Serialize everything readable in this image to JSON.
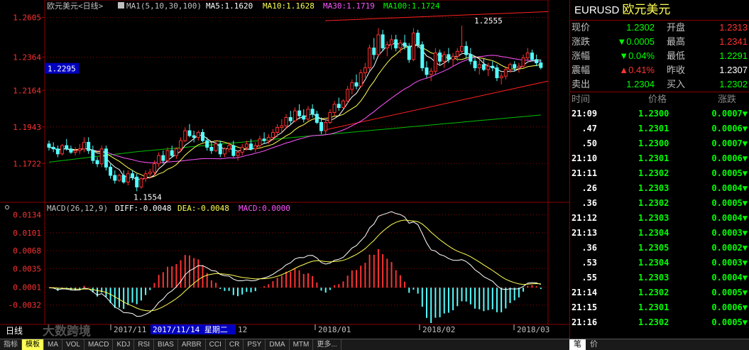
{
  "header": {
    "title": "欧元美元<日线>",
    "ma_label": "MA1(5,10,30,100)",
    "ma5": "MA5:1.1620",
    "ma10": "MA10:1.1628",
    "ma30": "MA30:1.1719",
    "ma100": "MA100:1.1724"
  },
  "price_axis": [
    "1.2605",
    "1.2364",
    "1.2164",
    "1.1943",
    "1.1722"
  ],
  "current_price_tag": "1.2295",
  "annotations": {
    "high": "1.2555",
    "low": "1.1554"
  },
  "macd": {
    "label": "MACD(26,12,9)",
    "diff": "DIFF:-0.0048",
    "dea": "DEA:-0.0048",
    "macd": "MACD:0.0000",
    "axis": [
      "0.0134",
      "0.0101",
      "0.0068",
      "0.0035",
      "0.0001",
      "-0.0032"
    ]
  },
  "date_axis": {
    "period": "日线",
    "labels": [
      "2017/11",
      "12",
      "2018/01",
      "2018/02",
      "2018/03"
    ],
    "cursor": "2017/11/14 星期二"
  },
  "watermark": "大数跨境",
  "tabs": [
    "指标",
    "模板",
    "MA",
    "VOL",
    "MACD",
    "KDJ",
    "RSI",
    "BIAS",
    "ARBR",
    "CCI",
    "CR",
    "PSY",
    "DMA",
    "MTM",
    "更多..."
  ],
  "panel": {
    "symbol": "EURUSD",
    "name": "欧元美元",
    "quotes": [
      {
        "l1": "现价",
        "v1": "1.2302",
        "c1": "green",
        "l2": "开盘",
        "v2": "1.2313",
        "c2": "red"
      },
      {
        "l1": "涨跌",
        "v1": "▼0.0005",
        "c1": "green",
        "l2": "最高",
        "v2": "1.2341",
        "c2": "red"
      },
      {
        "l1": "涨幅",
        "v1": "▼0.04%",
        "c1": "green",
        "l2": "最低",
        "v2": "1.2291",
        "c2": "green"
      },
      {
        "l1": "震幅",
        "v1": "▲0.41%",
        "c1": "red",
        "l2": "昨收",
        "v2": "1.2307",
        "c2": "white"
      },
      {
        "l1": "卖出",
        "v1": "1.2304",
        "c1": "green",
        "l2": "买入",
        "v2": "1.2302",
        "c2": "green"
      }
    ],
    "tick_headers": [
      "时间",
      "价格",
      "涨跌"
    ],
    "ticks": [
      {
        "t": "21:09",
        "p": "1.2300",
        "c": "0.0007▼"
      },
      {
        "t": ".47",
        "p": "1.2301",
        "c": "0.0006▼"
      },
      {
        "t": ".50",
        "p": "1.2300",
        "c": "0.0007▼"
      },
      {
        "t": "21:10",
        "p": "1.2301",
        "c": "0.0006▼"
      },
      {
        "t": "21:11",
        "p": "1.2302",
        "c": "0.0005▼"
      },
      {
        "t": ".26",
        "p": "1.2303",
        "c": "0.0004▼"
      },
      {
        "t": ".36",
        "p": "1.2302",
        "c": "0.0005▼"
      },
      {
        "t": "21:12",
        "p": "1.2303",
        "c": "0.0004▼"
      },
      {
        "t": "21:13",
        "p": "1.2304",
        "c": "0.0003▼"
      },
      {
        "t": ".36",
        "p": "1.2305",
        "c": "0.0002▼"
      },
      {
        "t": ".53",
        "p": "1.2304",
        "c": "0.0003▼"
      },
      {
        "t": ".55",
        "p": "1.2303",
        "c": "0.0004▼"
      },
      {
        "t": "21:14",
        "p": "1.2302",
        "c": "0.0005▼"
      },
      {
        "t": "21:15",
        "p": "1.2301",
        "c": "0.0006▼"
      },
      {
        "t": "21:16",
        "p": "1.2302",
        "c": "0.0005▼"
      }
    ],
    "bottom_tabs": [
      "笔",
      "价"
    ]
  },
  "colors": {
    "up": "#ff3232",
    "down": "#54ffff",
    "ma5": "#ffffff",
    "ma10": "#ffff54",
    "ma30": "#ff54ff",
    "ma100": "#00c000",
    "grid": "#8b0000",
    "trend": "#ff2020"
  },
  "chart_data": {
    "type": "candlestick",
    "price_range": [
      1.15,
      1.265
    ],
    "candles": [
      [
        1.184,
        1.186,
        1.18,
        1.182
      ],
      [
        1.182,
        1.185,
        1.179,
        1.181
      ],
      [
        1.181,
        1.183,
        1.176,
        1.178
      ],
      [
        1.178,
        1.184,
        1.177,
        1.183
      ],
      [
        1.183,
        1.187,
        1.18,
        1.181
      ],
      [
        1.181,
        1.183,
        1.178,
        1.179
      ],
      [
        1.179,
        1.182,
        1.177,
        1.18
      ],
      [
        1.18,
        1.184,
        1.178,
        1.181
      ],
      [
        1.181,
        1.188,
        1.179,
        1.185
      ],
      [
        1.185,
        1.188,
        1.178,
        1.18
      ],
      [
        1.18,
        1.183,
        1.172,
        1.174
      ],
      [
        1.174,
        1.176,
        1.17,
        1.172
      ],
      [
        1.172,
        1.183,
        1.17,
        1.181
      ],
      [
        1.181,
        1.183,
        1.168,
        1.17
      ],
      [
        1.17,
        1.172,
        1.163,
        1.165
      ],
      [
        1.165,
        1.168,
        1.16,
        1.162
      ],
      [
        1.162,
        1.166,
        1.161,
        1.165
      ],
      [
        1.165,
        1.168,
        1.16,
        1.161
      ],
      [
        1.161,
        1.168,
        1.159,
        1.166
      ],
      [
        1.166,
        1.168,
        1.162,
        1.164
      ],
      [
        1.164,
        1.166,
        1.1554,
        1.158
      ],
      [
        1.158,
        1.164,
        1.157,
        1.163
      ],
      [
        1.163,
        1.168,
        1.161,
        1.166
      ],
      [
        1.166,
        1.169,
        1.163,
        1.167
      ],
      [
        1.167,
        1.174,
        1.165,
        1.172
      ],
      [
        1.172,
        1.179,
        1.17,
        1.177
      ],
      [
        1.177,
        1.18,
        1.172,
        1.174
      ],
      [
        1.174,
        1.182,
        1.173,
        1.18
      ],
      [
        1.18,
        1.183,
        1.176,
        1.177
      ],
      [
        1.177,
        1.182,
        1.175,
        1.181
      ],
      [
        1.181,
        1.188,
        1.179,
        1.186
      ],
      [
        1.186,
        1.194,
        1.185,
        1.192
      ],
      [
        1.192,
        1.196,
        1.188,
        1.189
      ],
      [
        1.189,
        1.192,
        1.185,
        1.188
      ],
      [
        1.188,
        1.192,
        1.186,
        1.191
      ],
      [
        1.191,
        1.193,
        1.185,
        1.186
      ],
      [
        1.186,
        1.188,
        1.18,
        1.182
      ],
      [
        1.182,
        1.185,
        1.178,
        1.18
      ],
      [
        1.18,
        1.186,
        1.179,
        1.184
      ],
      [
        1.184,
        1.186,
        1.176,
        1.178
      ],
      [
        1.178,
        1.182,
        1.176,
        1.181
      ],
      [
        1.181,
        1.185,
        1.179,
        1.183
      ],
      [
        1.183,
        1.186,
        1.176,
        1.177
      ],
      [
        1.177,
        1.18,
        1.174,
        1.179
      ],
      [
        1.179,
        1.184,
        1.177,
        1.182
      ],
      [
        1.182,
        1.186,
        1.18,
        1.184
      ],
      [
        1.184,
        1.187,
        1.18,
        1.181
      ],
      [
        1.181,
        1.185,
        1.179,
        1.183
      ],
      [
        1.183,
        1.189,
        1.181,
        1.187
      ],
      [
        1.187,
        1.191,
        1.184,
        1.186
      ],
      [
        1.186,
        1.19,
        1.184,
        1.188
      ],
      [
        1.188,
        1.193,
        1.186,
        1.191
      ],
      [
        1.191,
        1.196,
        1.188,
        1.194
      ],
      [
        1.194,
        1.199,
        1.191,
        1.195
      ],
      [
        1.195,
        1.202,
        1.193,
        1.2
      ],
      [
        1.2,
        1.204,
        1.196,
        1.198
      ],
      [
        1.198,
        1.206,
        1.197,
        1.204
      ],
      [
        1.204,
        1.208,
        1.199,
        1.201
      ],
      [
        1.201,
        1.205,
        1.197,
        1.199
      ],
      [
        1.199,
        1.207,
        1.198,
        1.205
      ],
      [
        1.205,
        1.208,
        1.2,
        1.202
      ],
      [
        1.202,
        1.204,
        1.196,
        1.197
      ],
      [
        1.197,
        1.2,
        1.19,
        1.192
      ],
      [
        1.192,
        1.199,
        1.19,
        1.197
      ],
      [
        1.197,
        1.205,
        1.196,
        1.203
      ],
      [
        1.203,
        1.21,
        1.201,
        1.208
      ],
      [
        1.208,
        1.212,
        1.204,
        1.206
      ],
      [
        1.206,
        1.211,
        1.205,
        1.21
      ],
      [
        1.21,
        1.219,
        1.208,
        1.217
      ],
      [
        1.217,
        1.223,
        1.214,
        1.221
      ],
      [
        1.221,
        1.226,
        1.217,
        1.219
      ],
      [
        1.219,
        1.229,
        1.218,
        1.227
      ],
      [
        1.227,
        1.233,
        1.224,
        1.23
      ],
      [
        1.23,
        1.244,
        1.228,
        1.242
      ],
      [
        1.242,
        1.248,
        1.235,
        1.238
      ],
      [
        1.238,
        1.254,
        1.237,
        1.25
      ],
      [
        1.25,
        1.253,
        1.24,
        1.242
      ],
      [
        1.242,
        1.246,
        1.237,
        1.244
      ],
      [
        1.244,
        1.25,
        1.241,
        1.247
      ],
      [
        1.247,
        1.25,
        1.24,
        1.242
      ],
      [
        1.242,
        1.247,
        1.239,
        1.245
      ],
      [
        1.245,
        1.25,
        1.241,
        1.243
      ],
      [
        1.243,
        1.245,
        1.233,
        1.235
      ],
      [
        1.235,
        1.254,
        1.234,
        1.251
      ],
      [
        1.251,
        1.253,
        1.242,
        1.244
      ],
      [
        1.244,
        1.246,
        1.228,
        1.23
      ],
      [
        1.23,
        1.234,
        1.224,
        1.226
      ],
      [
        1.226,
        1.23,
        1.222,
        1.228
      ],
      [
        1.228,
        1.242,
        1.226,
        1.239
      ],
      [
        1.239,
        1.241,
        1.232,
        1.234
      ],
      [
        1.234,
        1.24,
        1.23,
        1.238
      ],
      [
        1.238,
        1.242,
        1.233,
        1.235
      ],
      [
        1.235,
        1.239,
        1.231,
        1.237
      ],
      [
        1.237,
        1.242,
        1.234,
        1.24
      ],
      [
        1.24,
        1.2555,
        1.238,
        1.243
      ],
      [
        1.243,
        1.246,
        1.236,
        1.238
      ],
      [
        1.238,
        1.242,
        1.232,
        1.234
      ],
      [
        1.234,
        1.236,
        1.228,
        1.23
      ],
      [
        1.23,
        1.235,
        1.226,
        1.232
      ],
      [
        1.232,
        1.236,
        1.228,
        1.229
      ],
      [
        1.229,
        1.233,
        1.225,
        1.231
      ],
      [
        1.231,
        1.234,
        1.228,
        1.23
      ],
      [
        1.23,
        1.232,
        1.222,
        1.224
      ],
      [
        1.224,
        1.227,
        1.22,
        1.225
      ],
      [
        1.225,
        1.231,
        1.223,
        1.229
      ],
      [
        1.229,
        1.233,
        1.227,
        1.232
      ],
      [
        1.232,
        1.234,
        1.228,
        1.23
      ],
      [
        1.23,
        1.233,
        1.227,
        1.231
      ],
      [
        1.231,
        1.238,
        1.23,
        1.236
      ],
      [
        1.236,
        1.242,
        1.234,
        1.239
      ],
      [
        1.239,
        1.241,
        1.234,
        1.235
      ],
      [
        1.235,
        1.238,
        1.231,
        1.233
      ],
      [
        1.233,
        1.235,
        1.2291,
        1.2302
      ]
    ]
  }
}
